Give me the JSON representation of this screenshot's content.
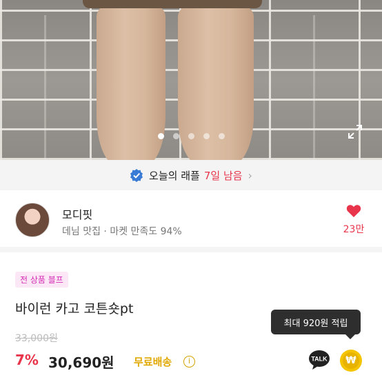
{
  "banner": {
    "text": "오늘의 래플",
    "days": "7일 남음",
    "chevron": "›"
  },
  "seller": {
    "name": "모디핏",
    "description": "데님 맛집 · 마켓 만족도 94%",
    "likes": "23만"
  },
  "product": {
    "promo_badge": "전 상품 블프",
    "title": "바이런 카고 코튼숏pt",
    "original_price": "33,000원",
    "discount": "7%",
    "price": "30,690원",
    "shipping": "무료배송",
    "info": "i"
  },
  "tooltip": {
    "text": "최대 920원 적립"
  },
  "actions": {
    "talk_label": "TALK",
    "won_label": "₩"
  },
  "carousel": {
    "total": 5,
    "active": 1
  },
  "colors": {
    "accent": "#e8354b",
    "promo": "#d62cb5",
    "shipping": "#e0a800",
    "won": "#f5c400"
  }
}
